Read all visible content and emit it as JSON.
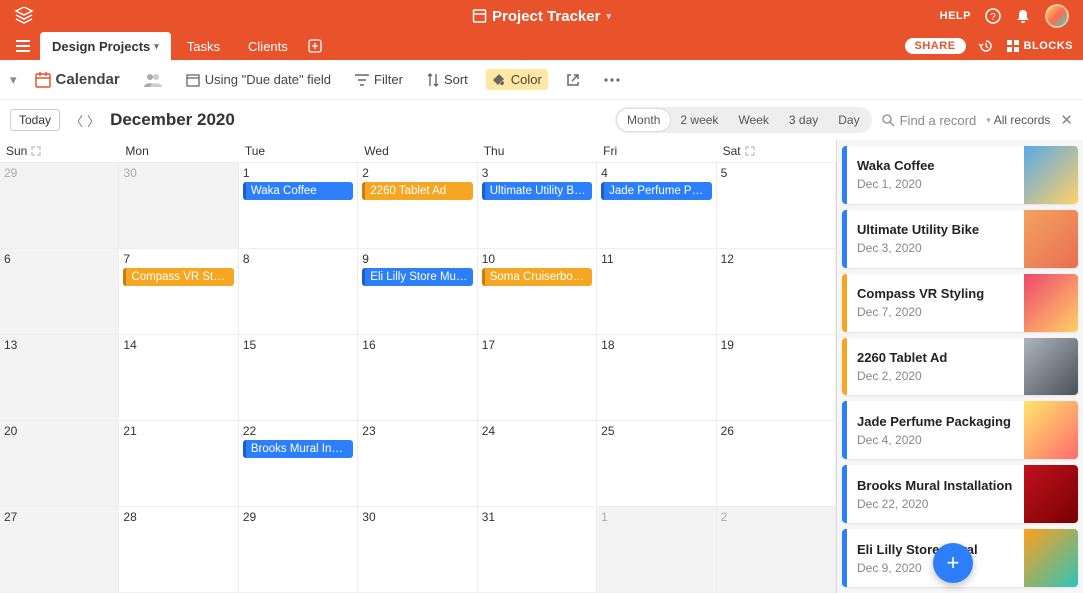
{
  "app": {
    "title": "Project Tracker",
    "help": "HELP",
    "share": "SHARE",
    "blocks": "BLOCKS"
  },
  "tabs": [
    {
      "label": "Design Projects",
      "active": true
    },
    {
      "label": "Tasks",
      "active": false
    },
    {
      "label": "Clients",
      "active": false
    }
  ],
  "toolbar": {
    "view_label": "Calendar",
    "using": "Using \"Due date\" field",
    "filter": "Filter",
    "sort": "Sort",
    "color": "Color"
  },
  "cal": {
    "today": "Today",
    "month_label": "December 2020",
    "segments": [
      "Month",
      "2 week",
      "Week",
      "3 day",
      "Day"
    ],
    "segment_active": "Month",
    "find_placeholder": "Find a record",
    "all_records": "All records",
    "dow": [
      "Sun",
      "Mon",
      "Tue",
      "Wed",
      "Thu",
      "Fri",
      "Sat"
    ]
  },
  "days": [
    {
      "n": "29",
      "gray": true
    },
    {
      "n": "30",
      "gray": true
    },
    {
      "n": "1",
      "ev": [
        {
          "t": "Waka Coffee",
          "c": "blue"
        }
      ]
    },
    {
      "n": "2",
      "ev": [
        {
          "t": "2260 Tablet Ad",
          "c": "orange"
        }
      ]
    },
    {
      "n": "3",
      "ev": [
        {
          "t": "Ultimate Utility Bike",
          "c": "blue"
        }
      ]
    },
    {
      "n": "4",
      "ev": [
        {
          "t": "Jade Perfume Pac…",
          "c": "blue"
        }
      ]
    },
    {
      "n": "5"
    },
    {
      "n": "6",
      "fc": true
    },
    {
      "n": "7",
      "ev": [
        {
          "t": "Compass VR Styli…",
          "c": "orange"
        }
      ]
    },
    {
      "n": "8"
    },
    {
      "n": "9",
      "ev": [
        {
          "t": "Eli Lilly Store Mural",
          "c": "blue"
        }
      ]
    },
    {
      "n": "10",
      "ev": [
        {
          "t": "Soma Cruiserboard",
          "c": "orange"
        }
      ]
    },
    {
      "n": "11"
    },
    {
      "n": "12"
    },
    {
      "n": "13",
      "fc": true
    },
    {
      "n": "14"
    },
    {
      "n": "15"
    },
    {
      "n": "16"
    },
    {
      "n": "17"
    },
    {
      "n": "18"
    },
    {
      "n": "19"
    },
    {
      "n": "20",
      "fc": true
    },
    {
      "n": "21"
    },
    {
      "n": "22",
      "ev": [
        {
          "t": "Brooks Mural Inst…",
          "c": "blue"
        }
      ]
    },
    {
      "n": "23"
    },
    {
      "n": "24"
    },
    {
      "n": "25"
    },
    {
      "n": "26"
    },
    {
      "n": "27",
      "fc": true
    },
    {
      "n": "28"
    },
    {
      "n": "29"
    },
    {
      "n": "30"
    },
    {
      "n": "31"
    },
    {
      "n": "1",
      "gray": true
    },
    {
      "n": "2",
      "gray": true
    }
  ],
  "records": [
    {
      "title": "Waka Coffee",
      "date": "Dec 1, 2020",
      "color": "blue",
      "thumb": "t0"
    },
    {
      "title": "Ultimate Utility Bike",
      "date": "Dec 3, 2020",
      "color": "blue",
      "thumb": "t1"
    },
    {
      "title": "Compass VR Styling",
      "date": "Dec 7, 2020",
      "color": "orange",
      "thumb": "t2"
    },
    {
      "title": "2260 Tablet Ad",
      "date": "Dec 2, 2020",
      "color": "orange",
      "thumb": "t3"
    },
    {
      "title": "Jade Perfume Packaging",
      "date": "Dec 4, 2020",
      "color": "blue",
      "thumb": "t4"
    },
    {
      "title": "Brooks Mural Installation",
      "date": "Dec 22, 2020",
      "color": "blue",
      "thumb": "t5"
    },
    {
      "title": "Eli Lilly Store Mural",
      "date": "Dec 9, 2020",
      "color": "blue",
      "thumb": "t6"
    }
  ]
}
